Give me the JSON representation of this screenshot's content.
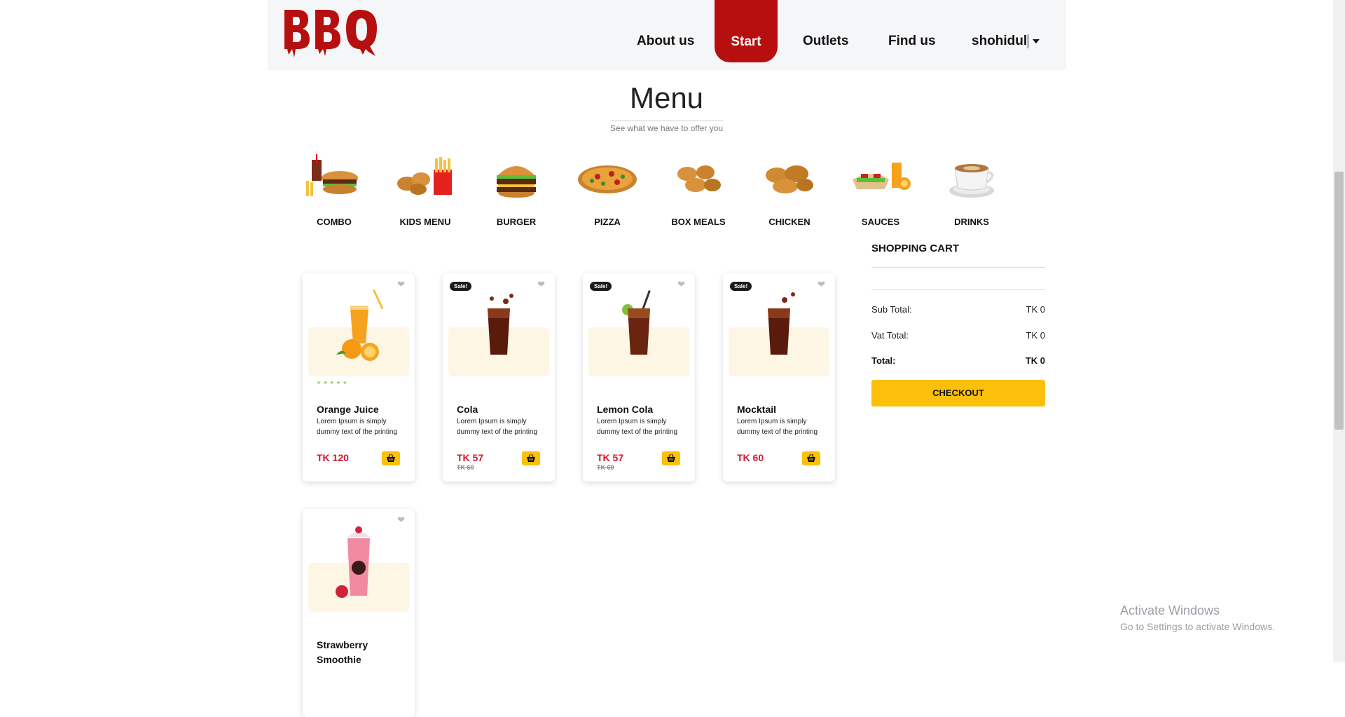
{
  "brand": {
    "logo_text": "BBQ",
    "color": "#b70f0f"
  },
  "nav": {
    "about": "About us",
    "start": "Start",
    "outlets": "Outlets",
    "find": "Find us",
    "user": "shohidul"
  },
  "menu": {
    "title": "Menu",
    "subtitle": "See what we have to offer you"
  },
  "categories": [
    {
      "label": "COMBO",
      "icon": "combo-meal-icon"
    },
    {
      "label": "KIDS MENU",
      "icon": "nuggets-fries-icon"
    },
    {
      "label": "BURGER",
      "icon": "burger-icon"
    },
    {
      "label": "PIZZA",
      "icon": "pizza-icon"
    },
    {
      "label": "BOX MEALS",
      "icon": "box-meal-icon"
    },
    {
      "label": "CHICKEN",
      "icon": "fried-chicken-icon"
    },
    {
      "label": "SAUCES",
      "icon": "sauces-icon"
    },
    {
      "label": "DRINKS",
      "icon": "coffee-cup-icon"
    }
  ],
  "products": [
    {
      "name": "Orange Juice",
      "desc": "Lorem Ipsum is simply dummy text of the printing",
      "price": "TK 120",
      "old_price": "",
      "badge": "",
      "rating": 0
    },
    {
      "name": "Cola",
      "desc": "Lorem Ipsum is simply dummy text of the printing",
      "price": "TK 57",
      "old_price": "TK 60",
      "badge": "Sale!"
    },
    {
      "name": "Lemon Cola",
      "desc": "Lorem Ipsum is simply dummy text of the printing",
      "price": "TK 57",
      "old_price": "TK 60",
      "badge": "Sale!"
    },
    {
      "name": "Mocktail",
      "desc": "Lorem Ipsum is simply dummy text of the printing",
      "price": "TK 60",
      "old_price": "",
      "badge": "Sale!"
    },
    {
      "name": "Strawberry Smoothie",
      "desc": "",
      "price": "",
      "old_price": "",
      "badge": ""
    }
  ],
  "cart": {
    "title": "SHOPPING CART",
    "subtotal_label": "Sub Total:",
    "subtotal_value": "TK 0",
    "vat_label": "Vat Total:",
    "vat_value": "TK 0",
    "total_label": "Total:",
    "total_value": "TK 0",
    "checkout_label": "CHECKOUT"
  },
  "colors": {
    "accent": "#fcbf0a",
    "price": "#d1192b",
    "nav_active": "#b70f0f"
  },
  "watermark": {
    "line1": "Activate Windows",
    "line2": "Go to Settings to activate Windows."
  }
}
